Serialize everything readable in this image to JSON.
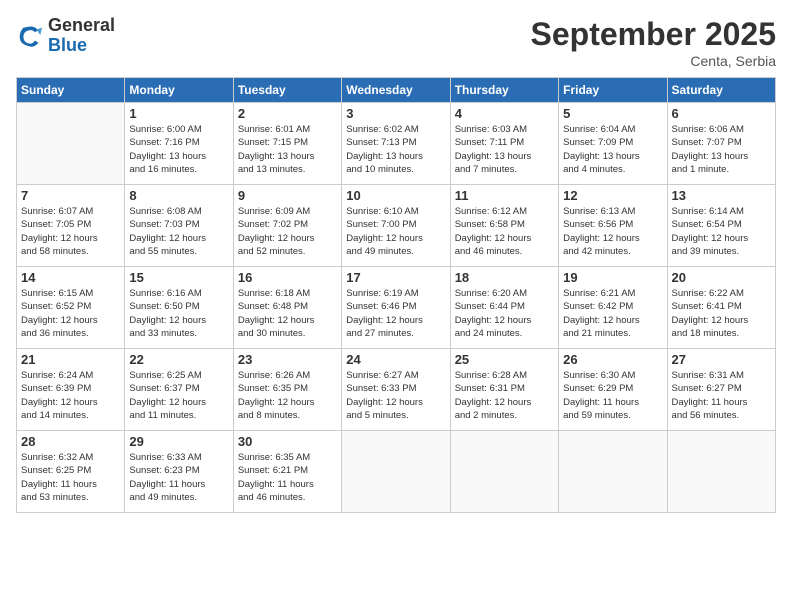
{
  "header": {
    "logo_general": "General",
    "logo_blue": "Blue",
    "month_title": "September 2025",
    "location": "Centa, Serbia"
  },
  "days_of_week": [
    "Sunday",
    "Monday",
    "Tuesday",
    "Wednesday",
    "Thursday",
    "Friday",
    "Saturday"
  ],
  "weeks": [
    [
      {
        "day": "",
        "info": ""
      },
      {
        "day": "1",
        "info": "Sunrise: 6:00 AM\nSunset: 7:16 PM\nDaylight: 13 hours\nand 16 minutes."
      },
      {
        "day": "2",
        "info": "Sunrise: 6:01 AM\nSunset: 7:15 PM\nDaylight: 13 hours\nand 13 minutes."
      },
      {
        "day": "3",
        "info": "Sunrise: 6:02 AM\nSunset: 7:13 PM\nDaylight: 13 hours\nand 10 minutes."
      },
      {
        "day": "4",
        "info": "Sunrise: 6:03 AM\nSunset: 7:11 PM\nDaylight: 13 hours\nand 7 minutes."
      },
      {
        "day": "5",
        "info": "Sunrise: 6:04 AM\nSunset: 7:09 PM\nDaylight: 13 hours\nand 4 minutes."
      },
      {
        "day": "6",
        "info": "Sunrise: 6:06 AM\nSunset: 7:07 PM\nDaylight: 13 hours\nand 1 minute."
      }
    ],
    [
      {
        "day": "7",
        "info": "Sunrise: 6:07 AM\nSunset: 7:05 PM\nDaylight: 12 hours\nand 58 minutes."
      },
      {
        "day": "8",
        "info": "Sunrise: 6:08 AM\nSunset: 7:03 PM\nDaylight: 12 hours\nand 55 minutes."
      },
      {
        "day": "9",
        "info": "Sunrise: 6:09 AM\nSunset: 7:02 PM\nDaylight: 12 hours\nand 52 minutes."
      },
      {
        "day": "10",
        "info": "Sunrise: 6:10 AM\nSunset: 7:00 PM\nDaylight: 12 hours\nand 49 minutes."
      },
      {
        "day": "11",
        "info": "Sunrise: 6:12 AM\nSunset: 6:58 PM\nDaylight: 12 hours\nand 46 minutes."
      },
      {
        "day": "12",
        "info": "Sunrise: 6:13 AM\nSunset: 6:56 PM\nDaylight: 12 hours\nand 42 minutes."
      },
      {
        "day": "13",
        "info": "Sunrise: 6:14 AM\nSunset: 6:54 PM\nDaylight: 12 hours\nand 39 minutes."
      }
    ],
    [
      {
        "day": "14",
        "info": "Sunrise: 6:15 AM\nSunset: 6:52 PM\nDaylight: 12 hours\nand 36 minutes."
      },
      {
        "day": "15",
        "info": "Sunrise: 6:16 AM\nSunset: 6:50 PM\nDaylight: 12 hours\nand 33 minutes."
      },
      {
        "day": "16",
        "info": "Sunrise: 6:18 AM\nSunset: 6:48 PM\nDaylight: 12 hours\nand 30 minutes."
      },
      {
        "day": "17",
        "info": "Sunrise: 6:19 AM\nSunset: 6:46 PM\nDaylight: 12 hours\nand 27 minutes."
      },
      {
        "day": "18",
        "info": "Sunrise: 6:20 AM\nSunset: 6:44 PM\nDaylight: 12 hours\nand 24 minutes."
      },
      {
        "day": "19",
        "info": "Sunrise: 6:21 AM\nSunset: 6:42 PM\nDaylight: 12 hours\nand 21 minutes."
      },
      {
        "day": "20",
        "info": "Sunrise: 6:22 AM\nSunset: 6:41 PM\nDaylight: 12 hours\nand 18 minutes."
      }
    ],
    [
      {
        "day": "21",
        "info": "Sunrise: 6:24 AM\nSunset: 6:39 PM\nDaylight: 12 hours\nand 14 minutes."
      },
      {
        "day": "22",
        "info": "Sunrise: 6:25 AM\nSunset: 6:37 PM\nDaylight: 12 hours\nand 11 minutes."
      },
      {
        "day": "23",
        "info": "Sunrise: 6:26 AM\nSunset: 6:35 PM\nDaylight: 12 hours\nand 8 minutes."
      },
      {
        "day": "24",
        "info": "Sunrise: 6:27 AM\nSunset: 6:33 PM\nDaylight: 12 hours\nand 5 minutes."
      },
      {
        "day": "25",
        "info": "Sunrise: 6:28 AM\nSunset: 6:31 PM\nDaylight: 12 hours\nand 2 minutes."
      },
      {
        "day": "26",
        "info": "Sunrise: 6:30 AM\nSunset: 6:29 PM\nDaylight: 11 hours\nand 59 minutes."
      },
      {
        "day": "27",
        "info": "Sunrise: 6:31 AM\nSunset: 6:27 PM\nDaylight: 11 hours\nand 56 minutes."
      }
    ],
    [
      {
        "day": "28",
        "info": "Sunrise: 6:32 AM\nSunset: 6:25 PM\nDaylight: 11 hours\nand 53 minutes."
      },
      {
        "day": "29",
        "info": "Sunrise: 6:33 AM\nSunset: 6:23 PM\nDaylight: 11 hours\nand 49 minutes."
      },
      {
        "day": "30",
        "info": "Sunrise: 6:35 AM\nSunset: 6:21 PM\nDaylight: 11 hours\nand 46 minutes."
      },
      {
        "day": "",
        "info": ""
      },
      {
        "day": "",
        "info": ""
      },
      {
        "day": "",
        "info": ""
      },
      {
        "day": "",
        "info": ""
      }
    ]
  ]
}
